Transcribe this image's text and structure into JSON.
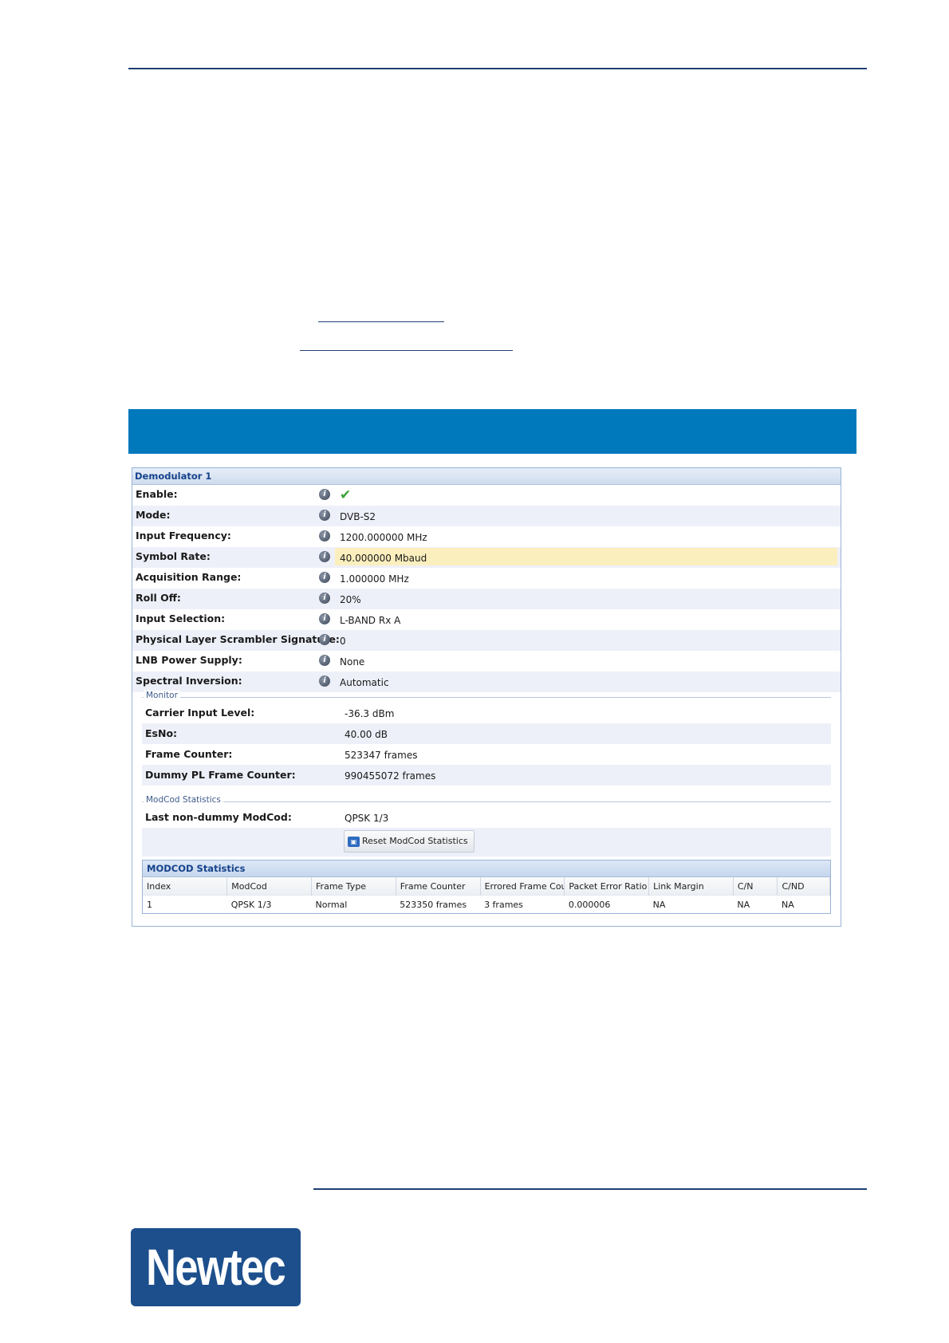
{
  "panel": {
    "title": "Demodulator 1",
    "settings": [
      {
        "label": "Enable:",
        "value": "",
        "check": true
      },
      {
        "label": "Mode:",
        "value": "DVB-S2"
      },
      {
        "label": "Input Frequency:",
        "value": "1200.000000 MHz"
      },
      {
        "label": "Symbol Rate:",
        "value": "40.000000 Mbaud",
        "highlighted": true
      },
      {
        "label": "Acquisition Range:",
        "value": "1.000000 MHz"
      },
      {
        "label": "Roll Off:",
        "value": "20%"
      },
      {
        "label": "Input Selection:",
        "value": "L-BAND Rx A"
      },
      {
        "label": "Physical Layer Scrambler Signature:",
        "value": "0"
      },
      {
        "label": "LNB Power Supply:",
        "value": "None"
      },
      {
        "label": "Spectral Inversion:",
        "value": "Automatic"
      }
    ],
    "info_icon_glyph": "i",
    "check_glyph": "✔",
    "monitor": {
      "legend": "Monitor",
      "rows": [
        {
          "label": "Carrier Input Level:",
          "value": "-36.3 dBm"
        },
        {
          "label": "EsNo:",
          "value": "40.00 dB"
        },
        {
          "label": "Frame Counter:",
          "value": "523347 frames"
        },
        {
          "label": "Dummy PL Frame Counter:",
          "value": "990455072 frames"
        }
      ]
    },
    "modcod_stats": {
      "legend": "ModCod Statistics",
      "last_label": "Last non-dummy ModCod:",
      "last_value": "QPSK 1/3",
      "reset_button": "Reset ModCod Statistics",
      "reset_icon_glyph": "▣",
      "grid_title": "MODCOD Statistics",
      "columns": [
        "Index",
        "ModCod",
        "Frame Type",
        "Frame Counter",
        "Errored Frame Count",
        "Packet Error Ratio",
        "Link Margin",
        "C/N",
        "C/ND"
      ],
      "rows": [
        [
          "1",
          "QPSK 1/3",
          "Normal",
          "523350 frames",
          "3 frames",
          "0.000006",
          "NA",
          "NA",
          "NA"
        ]
      ]
    }
  },
  "logo": {
    "text": "Newtec",
    "color": "#1d4f8c"
  },
  "colors": {
    "banner": "#0078bc",
    "rule": "#1f3f73",
    "highlight": "#fcefbe"
  }
}
